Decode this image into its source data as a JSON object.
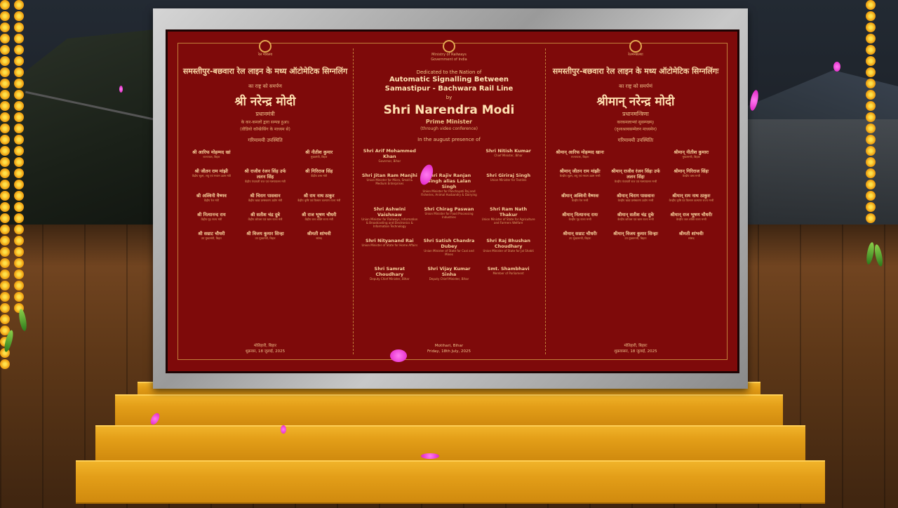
{
  "plaque": {
    "left": {
      "ministry": "रेल मंत्रालय",
      "title": "समस्तीपुर-बछवारा रेल लाइन के मध्य ऑटोमेटिक सिग्नलिंग",
      "dedication": "का राष्ट्र को समर्पण",
      "name": "श्री नरेन्द्र मोदी",
      "role": "प्रधानमंत्री",
      "note1": "के कर-कमलों द्वारा सम्पन्न हुआ।",
      "note2": "(वीडियो कॉन्फ्रेंसिंग के माध्यम से)",
      "presence": "गरिमामयी उपस्थिति",
      "dignitaries": [
        {
          "name": "श्री आरिफ मोहम्मद खां",
          "role": "राज्यपाल, बिहार"
        },
        {
          "name": "",
          "role": ""
        },
        {
          "name": "श्री नीतीश कुमार",
          "role": "मुख्यमंत्री, बिहार"
        },
        {
          "name": "श्री जीतन राम मांझी",
          "role": "केंद्रीय सूक्ष्म, लघु एवं मध्यम उद्यम मंत्री"
        },
        {
          "name": "श्री राजीव रंजन सिंह उर्फ ललन सिंह",
          "role": "केंद्रीय पंचायती राज एवं मत्स्यपालन मंत्री"
        },
        {
          "name": "श्री गिरिराज सिंह",
          "role": "केंद्रीय वस्त्र मंत्री"
        },
        {
          "name": "श्री अश्विनी वैष्णव",
          "role": "केंद्रीय रेल मंत्री"
        },
        {
          "name": "श्री चिराग पासवान",
          "role": "केंद्रीय खाद्य प्रसंस्करण उद्योग मंत्री"
        },
        {
          "name": "श्री राम नाथ ठाकुर",
          "role": "केंद्रीय कृषि एवं किसान कल्याण राज्य मंत्री"
        },
        {
          "name": "श्री नित्यानन्द राय",
          "role": "केंद्रीय गृह राज्य मंत्री"
        },
        {
          "name": "श्री सतीश चंद्र दुबे",
          "role": "केंद्रीय कोयला एवं खान राज्य मंत्री"
        },
        {
          "name": "श्री राज भूषण चौधरी",
          "role": "केंद्रीय जल शक्ति राज्य मंत्री"
        },
        {
          "name": "श्री सम्राट चौधरी",
          "role": "उप मुख्यमंत्री, बिहार"
        },
        {
          "name": "श्री विजय कुमार सिन्हा",
          "role": "उप मुख्यमंत्री, बिहार"
        },
        {
          "name": "श्रीमती शांभवी",
          "role": "सांसद"
        }
      ],
      "place": "मोतिहारी, बिहार",
      "date": "शुक्रवार, 18 जुलाई, 2025"
    },
    "center": {
      "ministry": "Ministry of Railways",
      "govt": "Government of India",
      "dedicated": "Dedicated to the Nation of",
      "title1": "Automatic Signalling Between",
      "title2": "Samastipur - Bachwara Rail Line",
      "by": "by",
      "name": "Shri Narendra Modi",
      "role": "Prime Minister",
      "note": "(through video conference)",
      "presence": "In the august presence of",
      "dignitaries": [
        {
          "name": "Shri Arif Mohammed Khan",
          "role": "Governor, Bihar"
        },
        {
          "name": "",
          "role": ""
        },
        {
          "name": "Shri Nitish Kumar",
          "role": "Chief Minister, Bihar"
        },
        {
          "name": "Shri Jitan Ram Manjhi",
          "role": "Union Minister for Micro, Small & Medium Enterprises"
        },
        {
          "name": "Shri Rajiv Ranjan Singh alias Lalan Singh",
          "role": "Union Minister for Panchayati Raj and Fisheries, Animal Husbandry & Dairying"
        },
        {
          "name": "Shri Giriraj Singh",
          "role": "Union Minister for Textiles"
        },
        {
          "name": "Shri Ashwini Vaishnaw",
          "role": "Union Minister for Railways, Information & Broadcasting and Electronics & Information Technology"
        },
        {
          "name": "Shri Chirag Paswan",
          "role": "Union Minister for Food Processing Industries"
        },
        {
          "name": "Shri Ram Nath Thakur",
          "role": "Union Minister of State for Agriculture and Farmers Welfare"
        },
        {
          "name": "Shri Nityanand Rai",
          "role": "Union Minister of State for Home Affairs"
        },
        {
          "name": "Shri Satish Chandra Dubey",
          "role": "Union Minister of State for Coal and Mines"
        },
        {
          "name": "Shri Raj Bhushan Choudhary",
          "role": "Union Minister of State for Jal Shakti"
        },
        {
          "name": "Shri Samrat Choudhary",
          "role": "Deputy Chief Minister, Bihar"
        },
        {
          "name": "Shri Vijay Kumar Sinha",
          "role": "Deputy Chief Minister, Bihar"
        },
        {
          "name": "Smt. Shambhavi",
          "role": "Member of Parliament"
        }
      ],
      "place": "Motihari, Bihar",
      "date": "Friday, 18th July, 2025"
    },
    "right": {
      "ministry": "रेलमन्त्रालयः",
      "title": "समस्तीपुर-बछवारा रेल लाइन के मध्य ऑटोमेटिक सिग्नलिंगः",
      "dedication": "का राष्ट्र को समर्पणं",
      "name": "श्रीमान् नरेन्द्र मोदी",
      "role": "प्रधानमन्त्रिणा",
      "note1": "करकमलाभ्यां सुसम्पन्नम्।",
      "note2": "(दृश्यश्रव्यसम्मेलन माध्यमेन)",
      "presence": "गरिमामयी उपस्थितिः",
      "dignitaries": [
        {
          "name": "श्रीमान् आरिफ मोहम्मद खानः",
          "role": "राज्यपालः, बिहारः"
        },
        {
          "name": "",
          "role": ""
        },
        {
          "name": "श्रीमान् नीतीश कुमारः",
          "role": "मुख्यमन्त्री, बिहारः"
        },
        {
          "name": "श्रीमान् जीतन राम मांझीः",
          "role": "केन्द्रीय सूक्ष्म, लघु एवं मध्यम उद्यम मन्त्री"
        },
        {
          "name": "श्रीमान् राजीव रंजन सिंहः उर्फ ललन सिंहः",
          "role": "केन्द्रीय पंचायती राज एवं मत्स्यपालन मन्त्री"
        },
        {
          "name": "श्रीमान् गिरिराज सिंहः",
          "role": "केन्द्रीय वस्त्र मन्त्री"
        },
        {
          "name": "श्रीमान् अश्विनी वैष्णवः",
          "role": "केन्द्रीय रेल मन्त्री"
        },
        {
          "name": "श्रीमान् चिराग पासवानः",
          "role": "केन्द्रीय खाद्य प्रसंस्करण उद्योग मन्त्री"
        },
        {
          "name": "श्रीमान् राम नाथ ठाकुरः",
          "role": "केन्द्रीय कृषि एवं किसान कल्याण राज्य मन्त्री"
        },
        {
          "name": "श्रीमान् नित्यानन्द रायः",
          "role": "केन्द्रीय गृह राज्य मन्त्री"
        },
        {
          "name": "श्रीमान् सतीश चंद्र दुबेः",
          "role": "केन्द्रीय कोयला एवं खान राज्य मन्त्री"
        },
        {
          "name": "श्रीमान् राज भूषण चौधरीः",
          "role": "केन्द्रीय जल शक्ति राज्य मन्त्री"
        },
        {
          "name": "श्रीमान् सम्राट चौधरीः",
          "role": "उप मुख्यमन्त्री, बिहारः"
        },
        {
          "name": "श्रीमान् विजय कुमार सिन्हाः",
          "role": "उप मुख्यमन्त्री, बिहारः"
        },
        {
          "name": "श्रीमती शांभवीः",
          "role": "सांसद"
        }
      ],
      "place": "मोतिहारी, बिहारः",
      "date": "शुक्रवासरः, 18 जुलाई, 2025"
    }
  },
  "colors": {
    "plaque": "#7e0a0a",
    "text": "#f3c98a",
    "pedestal": "#e39e18",
    "frame": "#b8b8b8",
    "petal": "#ff55e0"
  }
}
